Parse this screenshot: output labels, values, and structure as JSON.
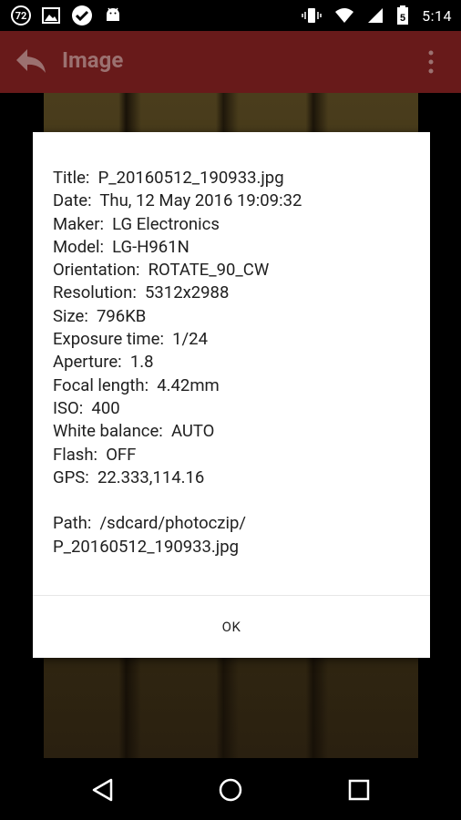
{
  "status_bar": {
    "badge": "72",
    "time": "5:14",
    "battery_level": "5"
  },
  "action_bar": {
    "title": "Image"
  },
  "dialog": {
    "fields": [
      {
        "label": "Title:",
        "value": "P_20160512_190933.jpg"
      },
      {
        "label": "Date:",
        "value": "Thu, 12 May 2016 19:09:32"
      },
      {
        "label": "Maker:",
        "value": "LG Electronics"
      },
      {
        "label": "Model:",
        "value": "LG-H961N"
      },
      {
        "label": "Orientation:",
        "value": "ROTATE_90_CW"
      },
      {
        "label": "Resolution:",
        "value": "5312x2988"
      },
      {
        "label": "Size:",
        "value": "796KB"
      },
      {
        "label": "Exposure time:",
        "value": "1/24"
      },
      {
        "label": "Aperture:",
        "value": "1.8"
      },
      {
        "label": "Focal length:",
        "value": "4.42mm"
      },
      {
        "label": "ISO:",
        "value": "400"
      },
      {
        "label": "White balance:",
        "value": "AUTO"
      },
      {
        "label": "Flash:",
        "value": "OFF"
      },
      {
        "label": "GPS:",
        "value": "22.333,114.16"
      }
    ],
    "path_label": "Path:",
    "path_value": "/sdcard/photoczip/",
    "path_value_line2": "P_20160512_190933.jpg",
    "ok_label": "OK"
  },
  "colors": {
    "action_bar": "#681a1a",
    "dialog_background": "#ffffff",
    "text": "#202020"
  }
}
